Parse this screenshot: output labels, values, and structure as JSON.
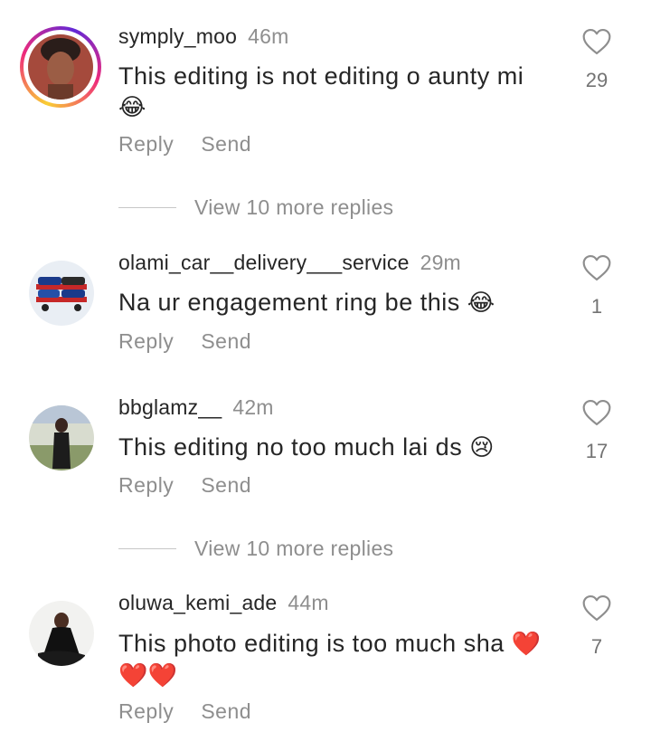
{
  "comments": [
    {
      "username": "symply_moo",
      "time": "46m",
      "text": "This editing is not editing o aunty mi",
      "emoji": "😂",
      "likes": "29",
      "reply_label": "Reply",
      "send_label": "Send",
      "has_story": true
    },
    {
      "username": "olami_car__delivery___service",
      "time": "29m",
      "text": "Na ur engagement ring be this",
      "emoji": "😂",
      "likes": "1",
      "reply_label": "Reply",
      "send_label": "Send",
      "has_story": false
    },
    {
      "username": "bbglamz__",
      "time": "42m",
      "text": "This editing no too much lai ds",
      "emoji": "😢",
      "likes": "17",
      "reply_label": "Reply",
      "send_label": "Send",
      "has_story": false
    },
    {
      "username": "oluwa_kemi_ade",
      "time": "44m",
      "text": "This photo editing is too much sha",
      "emoji": "❤️",
      "emoji_line2": "❤️❤️",
      "likes": "7",
      "reply_label": "Reply",
      "send_label": "Send",
      "has_story": false
    }
  ],
  "view_replies": [
    {
      "label": "View 10 more replies"
    },
    {
      "label": "View 10 more replies"
    }
  ],
  "icons": {
    "like": "heart-outline-icon",
    "emoji_color_heart": "#e0245e"
  }
}
